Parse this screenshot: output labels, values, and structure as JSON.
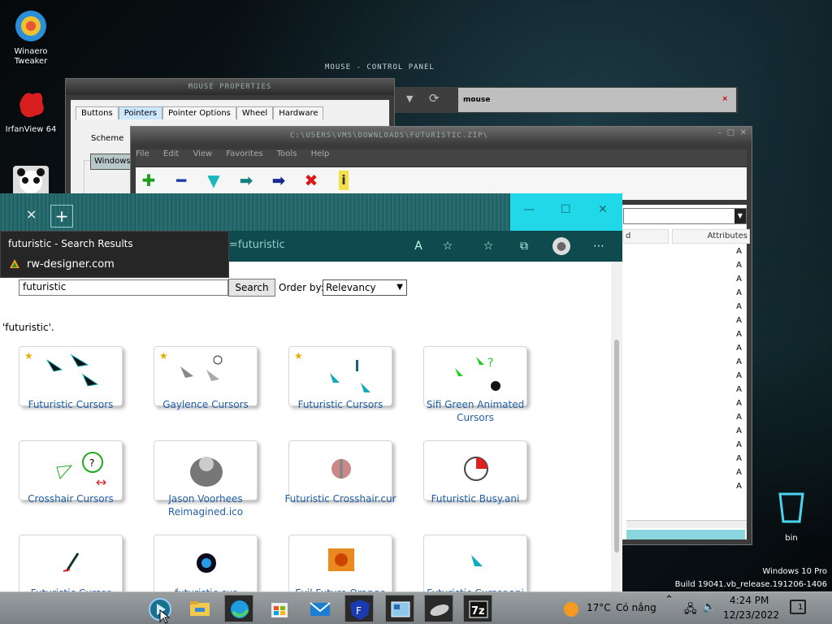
{
  "desktop": {
    "icons": [
      {
        "label": "Winaero Tweaker"
      },
      {
        "label": "IrfanView 64"
      }
    ],
    "recycle_bin": "bin",
    "watermark_line1": "Windows 10 Pro",
    "watermark_line2": "Build 19041.vb_release.191206-1406"
  },
  "control_panel": {
    "title": "MOUSE - CONTROL PANEL",
    "search_value": "mouse",
    "search_clear": "×"
  },
  "mouse_properties": {
    "title": "MOUSE PROPERTIES",
    "tabs": [
      "Buttons",
      "Pointers",
      "Pointer Options",
      "Wheel",
      "Hardware"
    ],
    "scheme_label": "Scheme",
    "scheme_value": "Windows"
  },
  "zip_window": {
    "title": "C:\\USERS\\VMS\\DOWNLOADS\\FUTURISTIC.ZIP\\",
    "menu": [
      "File",
      "Edit",
      "View",
      "Favorites",
      "Tools",
      "Help"
    ],
    "col_partial": "d",
    "col_attributes": "Attributes",
    "attr_letter": "A"
  },
  "browser": {
    "tab_close": "×",
    "new_tab": "+",
    "url_partial": "=futuristic",
    "suggest_title": "futuristic - Search Results",
    "suggest_site": "rw-designer.com",
    "search_value": "futuristic",
    "search_button": "Search",
    "order_label": "Order by:",
    "order_value": "Relevancy",
    "result_text": "'futuristic'.",
    "cards": [
      {
        "label": "Futuristic Cursors",
        "star": "★"
      },
      {
        "label": "Gaylence Cursors",
        "star": "★"
      },
      {
        "label": "Futuristic Cursors",
        "star": "★"
      },
      {
        "label": "Sifi Green Animated Cursors",
        "star": ""
      },
      {
        "label": "Crosshair Cursors",
        "star": ""
      },
      {
        "label": "Jason Voorhees Reimagined.ico",
        "star": ""
      },
      {
        "label": "Futuristic Crosshair.cur",
        "star": ""
      },
      {
        "label": "Futuristic Busy.ani",
        "star": ""
      },
      {
        "label": "Futuristic Cursor",
        "star": ""
      },
      {
        "label": "futuristic.cur",
        "star": ""
      },
      {
        "label": "Evil Future Orange",
        "star": ""
      },
      {
        "label": "Futuristic Cursor.ani",
        "star": ""
      }
    ]
  },
  "taskbar": {
    "weather_temp": "17°C",
    "weather_text": "Có nắng",
    "time": "4:24 PM",
    "date": "12/23/2022",
    "notification_count": "1"
  }
}
